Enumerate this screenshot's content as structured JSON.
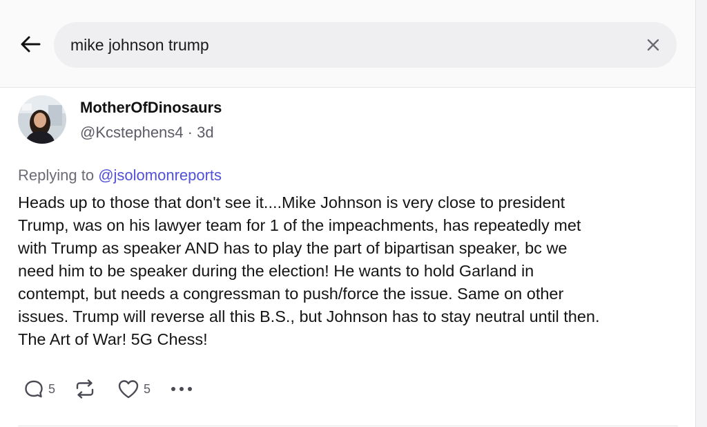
{
  "search": {
    "value": "mike johnson trump"
  },
  "post": {
    "display_name": "MotherOfDinosaurs",
    "handle": "@Kcstephens4",
    "separator": " · ",
    "age": "3d",
    "replying_prefix": "Replying to ",
    "replying_to": "@jsolomonreports",
    "text": "Heads up to those that don't see it....Mike Johnson is very close to president\nTrump,  was on his lawyer team for 1 of the impeachments, has repeatedly met\nwith Trump as speaker AND has to play the part of bipartisan speaker, bc we\nneed him to be speaker during the election! He wants to hold Garland in\ncontempt, but needs a congressman to push/force the issue. Same on other\nissues. Trump will reverse all this B.S., but Johnson has to stay neutral until then.\nThe Art of War! 5G Chess!",
    "reply_count": "5",
    "like_count": "5"
  },
  "icons": {
    "back": "arrow-left-icon",
    "clear": "close-icon",
    "reply": "speech-bubble-icon",
    "repost": "repost-arrows-icon",
    "like": "heart-icon",
    "more": "ellipsis-icon"
  },
  "colors": {
    "link": "#5050d8",
    "muted": "#5b5b66",
    "search_bg": "#efeff1"
  }
}
